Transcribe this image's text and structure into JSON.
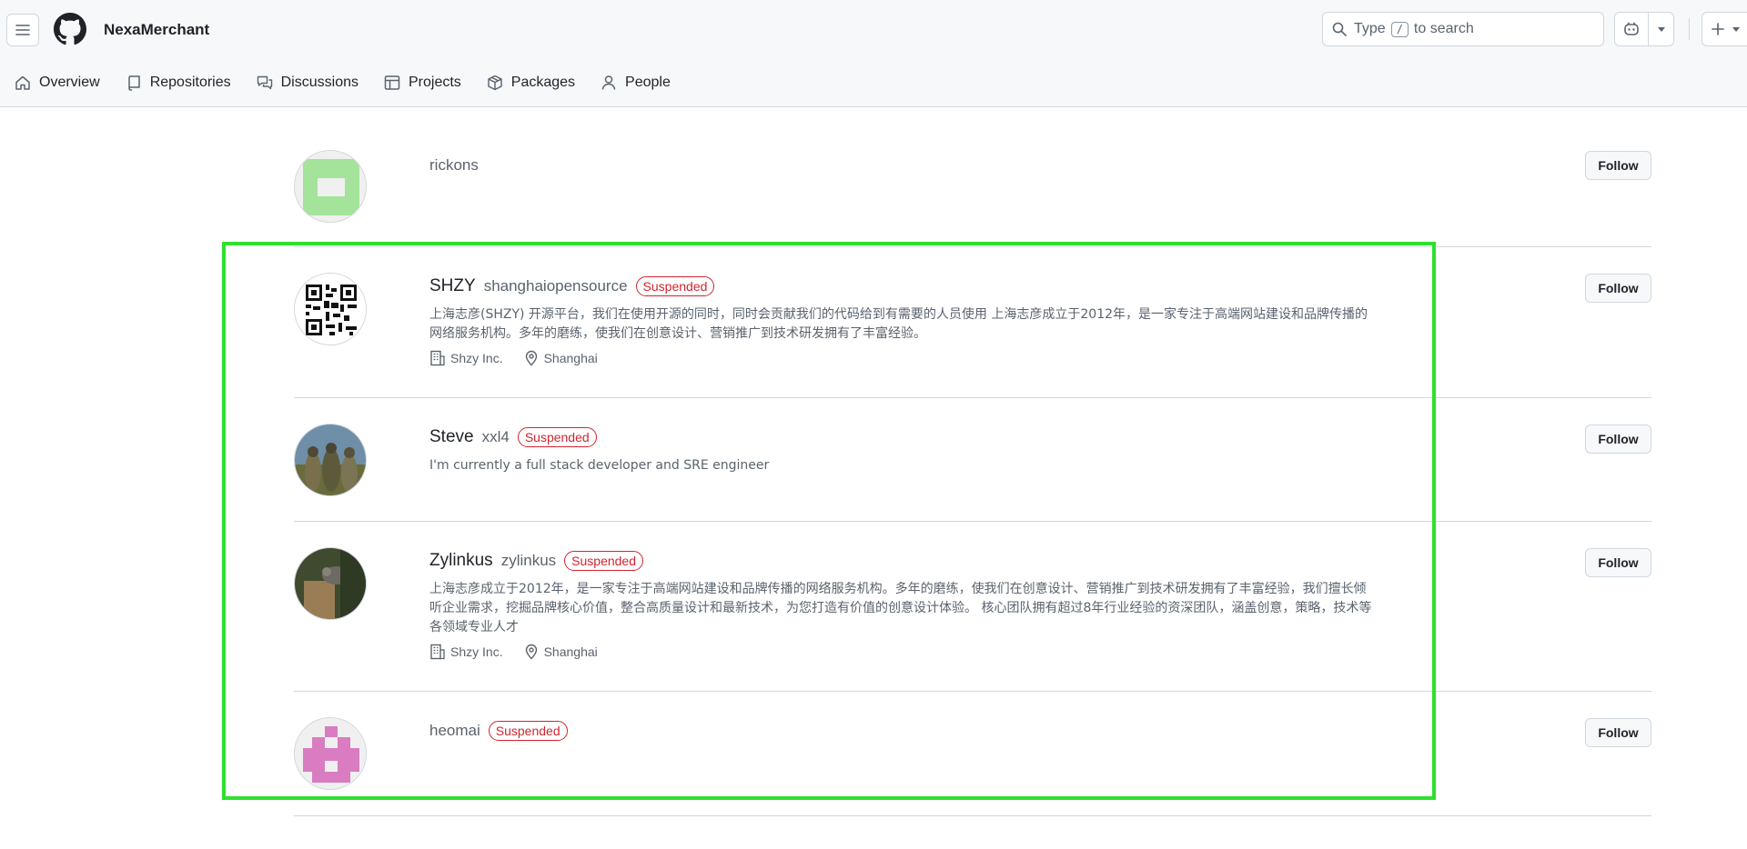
{
  "header": {
    "org_name": "NexaMerchant",
    "search": {
      "prefix": "Type",
      "key": "/",
      "suffix": "to search"
    }
  },
  "tabs": [
    {
      "label": "Overview",
      "icon": "home-icon"
    },
    {
      "label": "Repositories",
      "icon": "repo-icon"
    },
    {
      "label": "Discussions",
      "icon": "discussions-icon"
    },
    {
      "label": "Projects",
      "icon": "table-icon"
    },
    {
      "label": "Packages",
      "icon": "package-icon"
    },
    {
      "label": "People",
      "icon": "person-icon"
    }
  ],
  "people": [
    {
      "display_name": "",
      "login": "rickons",
      "badge": "",
      "bio": "",
      "company": "",
      "location": "",
      "follow_label": "Follow"
    },
    {
      "display_name": "SHZY",
      "login": "shanghaiopensource",
      "badge": "Suspended",
      "bio": "上海志彦(SHZY) 开源平台，我们在使用开源的同时，同时会贡献我们的代码给到有需要的人员使用 上海志彦成立于2012年，是一家专注于高端网站建设和品牌传播的网络服务机构。多年的磨练，使我们在创意设计、营销推广到技术研发拥有了丰富经验。",
      "company": "Shzy Inc.",
      "location": "Shanghai",
      "follow_label": "Follow"
    },
    {
      "display_name": "Steve",
      "login": "xxl4",
      "badge": "Suspended",
      "bio": "I'm currently a full stack developer and SRE engineer",
      "company": "",
      "location": "",
      "follow_label": "Follow"
    },
    {
      "display_name": "Zylinkus",
      "login": "zylinkus",
      "badge": "Suspended",
      "bio": "上海志彦成立于2012年，是一家专注于高端网站建设和品牌传播的网络服务机构。多年的磨练，使我们在创意设计、营销推广到技术研发拥有了丰富经验，我们擅长倾听企业需求，挖掘品牌核心价值，整合高质量设计和最新技术，为您打造有价值的创意设计体验。 核心团队拥有超过8年行业经验的资深团队，涵盖创意，策略，技术等各领域专业人才",
      "company": "Shzy Inc.",
      "location": "Shanghai",
      "follow_label": "Follow"
    },
    {
      "display_name": "",
      "login": "heomai",
      "badge": "Suspended",
      "bio": "",
      "company": "",
      "location": "",
      "follow_label": "Follow"
    }
  ],
  "colors": {
    "highlight": "#2ee02e",
    "suspended": "#d1242f",
    "identicon_green": "#a3e39a",
    "identicon_pink": "#d97cc1"
  }
}
